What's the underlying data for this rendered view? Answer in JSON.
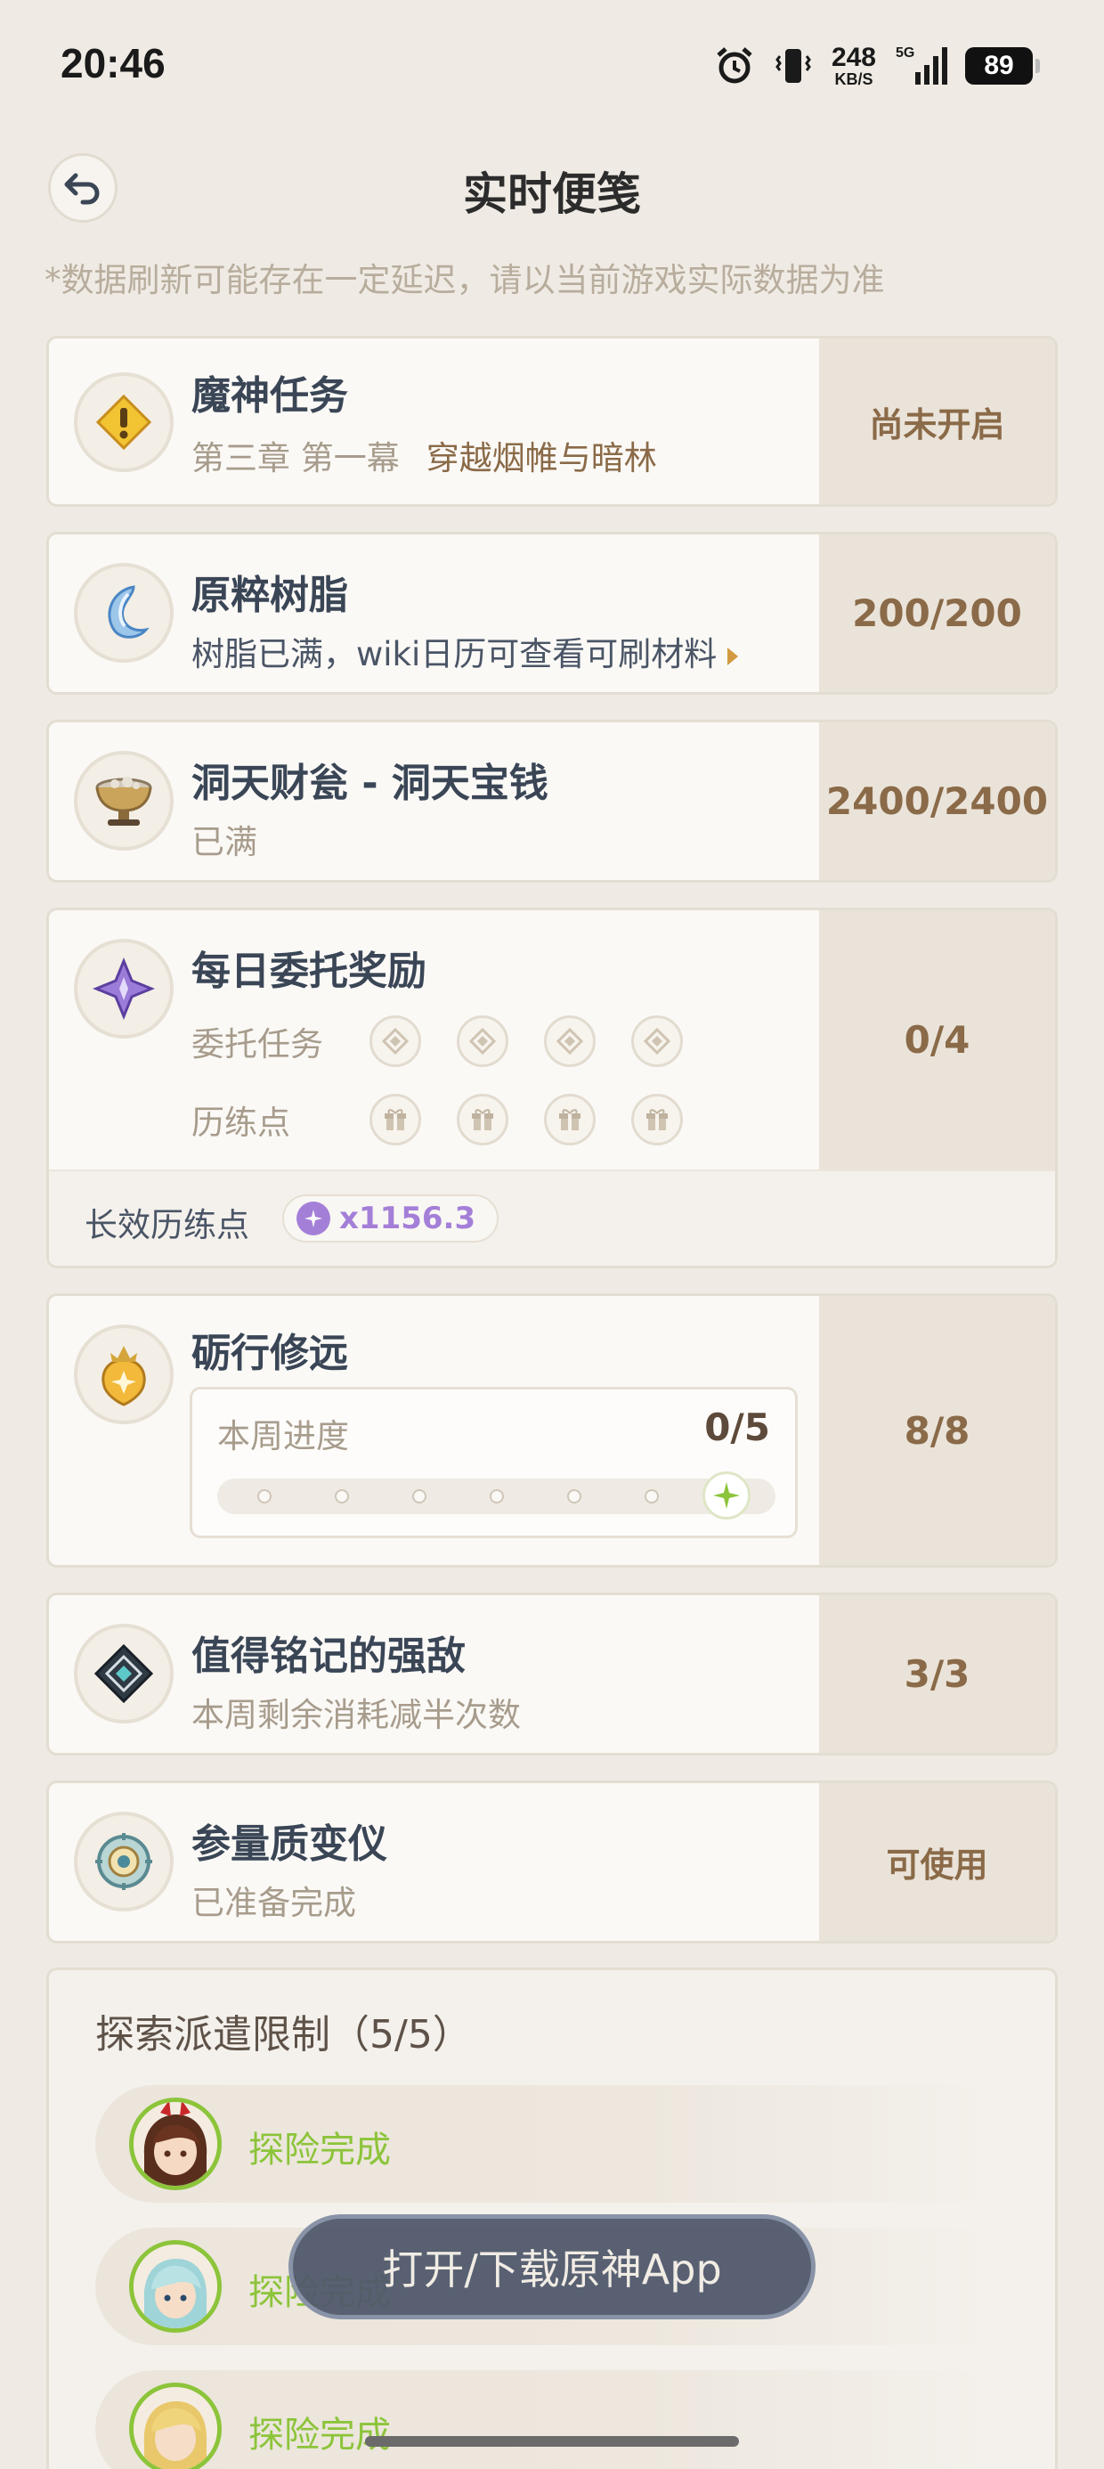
{
  "status_bar": {
    "time": "20:46",
    "net_speed": "248",
    "net_unit": "KB/S",
    "net_type": "5G",
    "battery": "89"
  },
  "header": {
    "title": "实时便笺",
    "notice": "*数据刷新可能存在一定延迟，请以当前游戏实际数据为准"
  },
  "archon_quest": {
    "title": "魔神任务",
    "chapter": "第三章 第一幕",
    "quest_name": "穿越烟帷与暗林",
    "status": "尚未开启"
  },
  "resin": {
    "title": "原粹树脂",
    "subtitle": "树脂已满，wiki日历可查看可刷材料",
    "value": "200/200"
  },
  "realm_currency": {
    "title": "洞天财瓮 - 洞天宝钱",
    "subtitle": "已满",
    "value": "2400/2400"
  },
  "daily_commission": {
    "title": "每日委托奖励",
    "tasks_label": "委托任务",
    "points_label": "历练点",
    "value": "0/4",
    "long_term_label": "长效历练点",
    "long_term_value": "x1156.3"
  },
  "weekly": {
    "title": "砺行修远",
    "progress_label": "本周进度",
    "progress_value": "0/5",
    "value": "8/8"
  },
  "weekly_boss": {
    "title": "值得铭记的强敌",
    "subtitle": "本周剩余消耗减半次数",
    "value": "3/3"
  },
  "transformer": {
    "title": "参量质变仪",
    "subtitle": "已准备完成",
    "value": "可使用"
  },
  "expedition": {
    "title": "探索派遣限制（5/5）",
    "rows": [
      {
        "status": "探险完成"
      },
      {
        "status": "探险完成"
      },
      {
        "status": "探险完成"
      }
    ]
  },
  "toast": {
    "label": "打开/下载原神App"
  },
  "colors": {
    "background": "#efebe4",
    "accent_brown": "#8a6a48",
    "complete_green": "#8cc43a",
    "purple": "#a47fd8"
  }
}
